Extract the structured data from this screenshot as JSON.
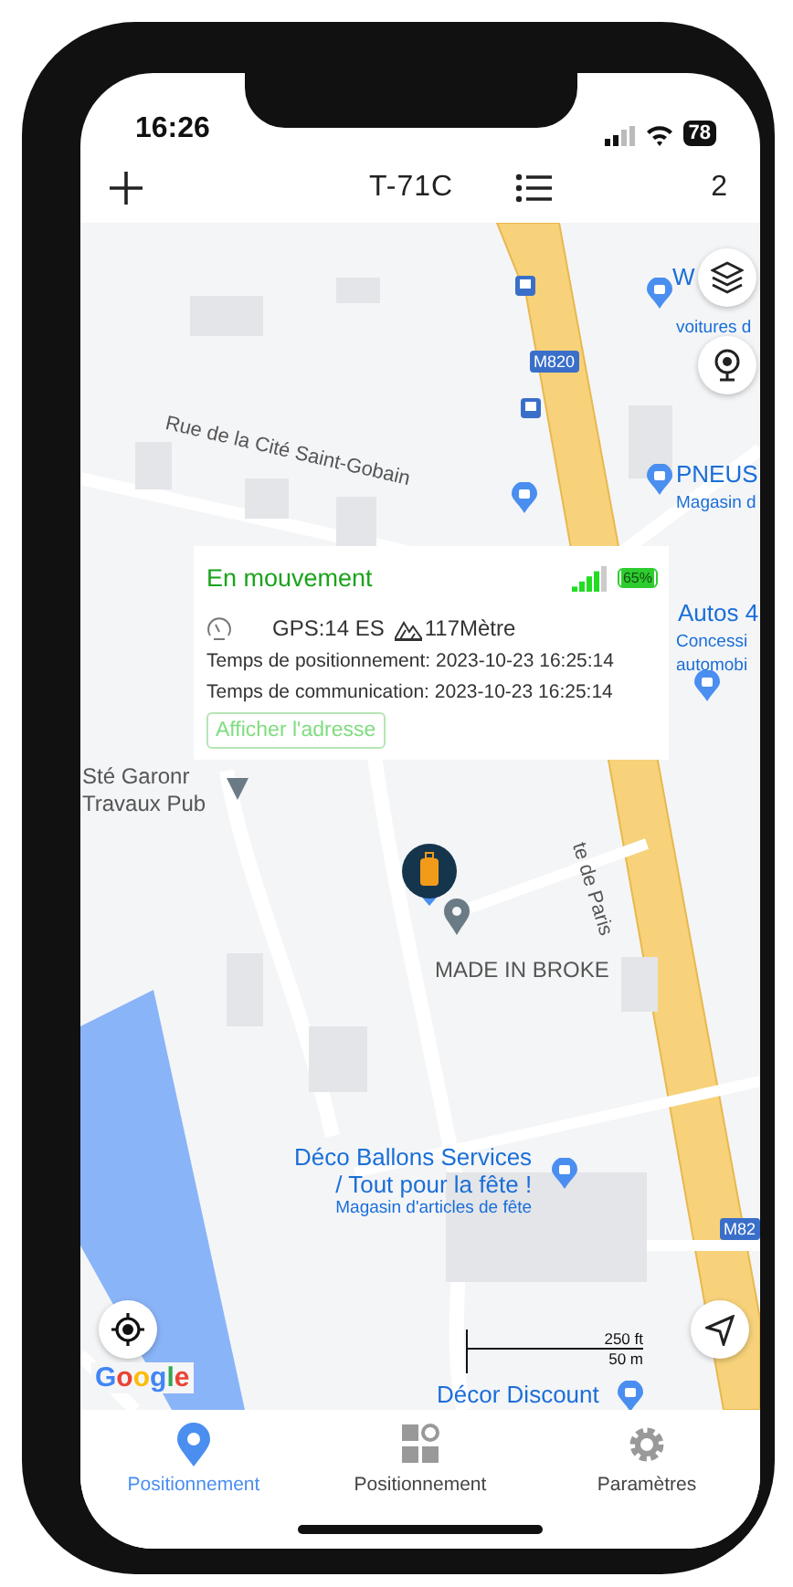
{
  "status_bar": {
    "time": "16:26",
    "battery": "78"
  },
  "header": {
    "title": "T-71C",
    "count": "2"
  },
  "map": {
    "labels": [
      {
        "text": "Rue de la Cité Saint-Gobain",
        "kind": "street"
      },
      {
        "text": "W",
        "kind": "poi"
      },
      {
        "text": "voitures d",
        "kind": "sub"
      },
      {
        "text": "M820",
        "kind": "shield"
      },
      {
        "text": "PNEUS",
        "kind": "poi"
      },
      {
        "text": "Magasin d",
        "kind": "sub"
      },
      {
        "text": "Autos 4",
        "kind": "poi"
      },
      {
        "text": "Concessi",
        "kind": "sub"
      },
      {
        "text": "automobi",
        "kind": "sub"
      },
      {
        "text": "Sté Garonr",
        "kind": "place"
      },
      {
        "text": "Travaux Pub",
        "kind": "place"
      },
      {
        "text": "te de Paris",
        "kind": "street"
      },
      {
        "text": "MADE IN BROKE",
        "kind": "place"
      },
      {
        "text": "M82",
        "kind": "shield"
      },
      {
        "text": "Décor Discount",
        "kind": "poi"
      }
    ],
    "poi_block": {
      "lines": [
        "Déco Ballons Services",
        "/ Tout pour la fête !",
        "Magasin d'articles de fête"
      ]
    },
    "info_card": {
      "status": "En mouvement",
      "battery": "65%",
      "gps": "GPS:14 ES",
      "altitude": "117Mètre",
      "position_time": "Temps de positionnement: 2023-10-23 16:25:14",
      "communication_time": "Temps de communication: 2023-10-23 16:25:14",
      "button": "Afficher l'adresse"
    },
    "scale": [
      "250 ft",
      "50 m"
    ],
    "attribution": [
      "G",
      "o",
      "o",
      "g",
      "l",
      "e"
    ]
  },
  "tabs": [
    {
      "label": "Positionnement",
      "selected": true
    },
    {
      "label": "Positionnement",
      "selected": false
    },
    {
      "label": "Paramètres",
      "selected": false
    }
  ]
}
